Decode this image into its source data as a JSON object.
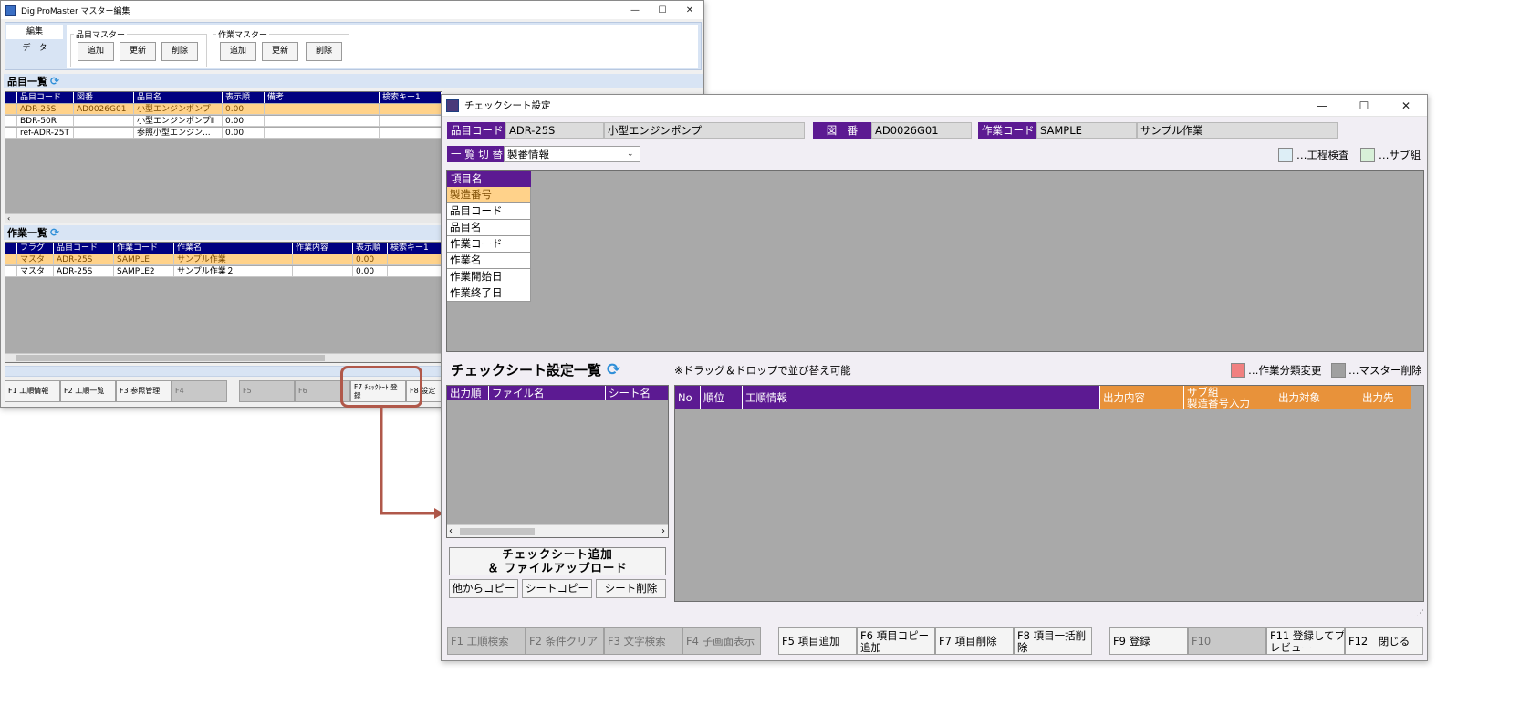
{
  "back_window": {
    "title": "DigiProMaster マスター編集",
    "controls": {
      "minimize": "—",
      "maximize": "☐",
      "close": "✕"
    },
    "side_tabs": [
      "編集",
      "データ"
    ],
    "group_hinmoku": {
      "title": "品目マスター",
      "buttons": [
        "追加",
        "更新",
        "削除"
      ]
    },
    "group_sagyo": {
      "title": "作業マスター",
      "buttons": [
        "追加",
        "更新",
        "削除"
      ]
    },
    "hinmoku_list": {
      "title": "品目一覧",
      "columns": [
        "品目コード",
        "図番",
        "品目名",
        "表示順",
        "備考",
        "検索キー1"
      ],
      "rows": [
        [
          "ADR-25S",
          "AD0026G01",
          "小型エンジンポンプ",
          "0.00",
          "",
          ""
        ],
        [
          "BDR-50R",
          "",
          "小型エンジンポンプⅡ",
          "0.00",
          "",
          ""
        ],
        [
          "ref-ADR-25T",
          "",
          "参照小型エンジン...",
          "0.00",
          "",
          ""
        ]
      ]
    },
    "sagyo_list": {
      "title": "作業一覧",
      "columns": [
        "フラグ",
        "品目コード",
        "作業コード",
        "作業名",
        "作業内容",
        "表示順",
        "検索キー1"
      ],
      "rows": [
        [
          "マスタ",
          "ADR-25S",
          "SAMPLE",
          "サンプル作業",
          "",
          "0.00",
          ""
        ],
        [
          "マスタ",
          "ADR-25S",
          "SAMPLE2",
          "サンプル作業２",
          "",
          "0.00",
          ""
        ]
      ]
    },
    "fkeys": [
      "F1 工順情報",
      "F2 工順一覧",
      "F3 参照管理",
      "F4",
      "F5",
      "F6",
      "F7 ﾁｪｯｸｼｰﾄ 登録",
      "F8 設定"
    ]
  },
  "front_window": {
    "title": "チェックシート設定",
    "controls": {
      "minimize": "—",
      "maximize": "☐",
      "close": "✕"
    },
    "header_fields": {
      "hinmoku_code_label": "品目コード",
      "hinmoku_code": "ADR-25S",
      "hinmoku_name": "小型エンジンポンプ",
      "zuban_label": "図　番",
      "zuban": "AD0026G01",
      "sagyo_code_label": "作業コード",
      "sagyo_code": "SAMPLE",
      "sagyo_name": "サンプル作業"
    },
    "list_switch": {
      "label": "一 覧 切 替",
      "value": "製番情報"
    },
    "legend_top": [
      {
        "text": "…工程検査",
        "color": "#ddeef6"
      },
      {
        "text": "…サブ組",
        "color": "#d8f0d8"
      }
    ],
    "item_table": {
      "header": "項目名",
      "items": [
        "製造番号",
        "品目コード",
        "品目名",
        "作業コード",
        "作業名",
        "作業開始日",
        "作業終了日"
      ]
    },
    "checksheet_section": {
      "title": "チェックシート設定一覧",
      "note": "※ドラッグ＆ドロップで並び替え可能",
      "legend": [
        {
          "text": "…作業分類変更",
          "color": "#f08080"
        },
        {
          "text": "…マスター削除",
          "color": "#a0a0a0"
        }
      ],
      "sheet_columns": [
        "出力順",
        "ファイル名",
        "シート名"
      ],
      "process_columns": [
        "No",
        "順位",
        "工順情報",
        "出力内容",
        "サブ組\n製造番号入力",
        "出力対象",
        "出力先"
      ]
    },
    "buttons": {
      "add_upload": "チェックシート追加\n＆ ファイルアップロード",
      "copy_from_other": "他からコピー",
      "sheet_copy": "シートコピー",
      "sheet_delete": "シート削除"
    },
    "fkeys": [
      {
        "label": "F1 工順検索",
        "enabled": false
      },
      {
        "label": "F2 条件クリア",
        "enabled": false
      },
      {
        "label": "F3 文字検索",
        "enabled": false
      },
      {
        "label": "F4 子画面表示",
        "enabled": false
      },
      {
        "label": "F5 項目追加",
        "enabled": true
      },
      {
        "label": "F6 項目コピー\n追加",
        "enabled": true
      },
      {
        "label": "F7 項目削除",
        "enabled": true
      },
      {
        "label": "F8 項目一括削\n除",
        "enabled": true
      },
      {
        "label": "F9 登録",
        "enabled": true
      },
      {
        "label": "F10",
        "enabled": false
      },
      {
        "label": "F11 登録してプ\nレビュー",
        "enabled": true
      },
      {
        "label": "F12　閉じる",
        "enabled": true
      }
    ]
  },
  "colors": {
    "accent_purple": "#5c1a92",
    "accent_orange": "#e8923a",
    "grid_header_navy": "#000080",
    "highlight_row": "#ffd28a",
    "callout": "#b0584a"
  }
}
